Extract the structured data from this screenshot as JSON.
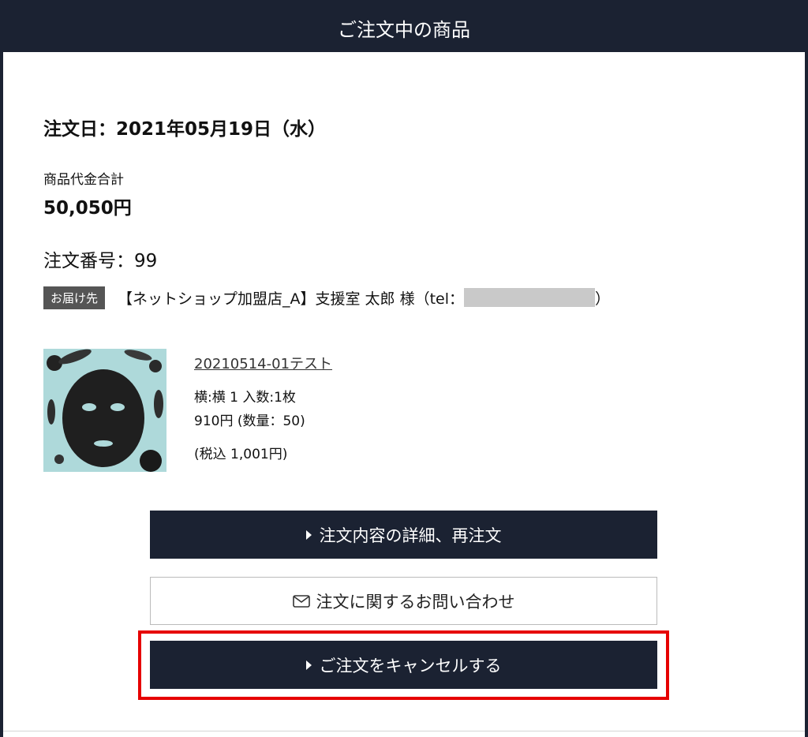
{
  "header": {
    "title": "ご注文中の商品"
  },
  "order": {
    "date_text": "注文日：2021年05月19日（水）",
    "subtotal_label": "商品代金合計",
    "subtotal_value": "50,050円",
    "number_text": "注文番号：99",
    "destination_badge": "お届け先",
    "destination_text": "【ネットショップ加盟店_A】支援室 太郎 様（tel：",
    "destination_close": "）"
  },
  "product": {
    "name": "20210514-01テスト",
    "variant": "横:横 1  入数:1枚",
    "price": "910円 (数量：50)",
    "tax_included": "(税込 1,001円)",
    "image_icon": "charcoal-face-mask-image"
  },
  "buttons": {
    "detail_reorder": "注文内容の詳細、再注文",
    "inquiry": "注文に関するお問い合わせ",
    "cancel": "ご注文をキャンセルする"
  },
  "colors": {
    "header_bg": "#1b2232",
    "button_dark": "#1b2232",
    "highlight": "#e60000"
  }
}
